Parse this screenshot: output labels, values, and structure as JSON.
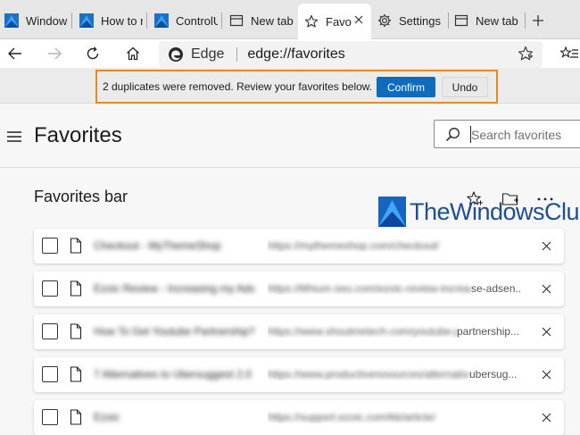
{
  "tabs": [
    {
      "label": "Window",
      "icon": "windows-club-favicon"
    },
    {
      "label": "How to r",
      "icon": "windows-club-favicon"
    },
    {
      "label": "ControlU",
      "icon": "windows-club-favicon"
    },
    {
      "label": "New tab",
      "icon": "new-tab-icon"
    },
    {
      "label": "Favo",
      "icon": "star-icon",
      "active": true
    },
    {
      "label": "Settings",
      "icon": "gear-icon"
    },
    {
      "label": "New tab",
      "icon": "new-tab-icon"
    }
  ],
  "address_bar": {
    "brand": "Edge",
    "url": "edge://favorites"
  },
  "notification": {
    "message": "2 duplicates were removed. Review your favorites below.",
    "confirm_label": "Confirm",
    "undo_label": "Undo"
  },
  "page": {
    "title": "Favorites",
    "search_placeholder": "Search favorites",
    "section_title": "Favorites bar"
  },
  "watermark": {
    "text": "TheWindowsClub"
  },
  "favorites": [
    {
      "title": "Checkout - MyThemeShop",
      "url": "https://mythemeshop.com/checkout/",
      "url_tail": ""
    },
    {
      "title": "Ezoic Review - Increasing my Ads...",
      "url": "https://lithium-seo.com/ezoic-review-increase-adsen",
      "url_tail": "se-adsen..."
    },
    {
      "title": "How To Get Youtube Partnership?",
      "url": "https://www.shoutmetech.com/youtube-partnership",
      "url_tail": "partnership..."
    },
    {
      "title": "7 Alternatives to Ubersuggest 2.0",
      "url": "https://www.productiveresources/alternatives-ubersugg",
      "url_tail": "ubersug..."
    },
    {
      "title": "Ezoic",
      "url": "https://support.ezoic.com/kb/article/",
      "url_tail": ""
    }
  ],
  "colors": {
    "accent": "#0f6cbd",
    "highlight_border": "#e58a1d",
    "watermark": "#1d4e8f"
  }
}
